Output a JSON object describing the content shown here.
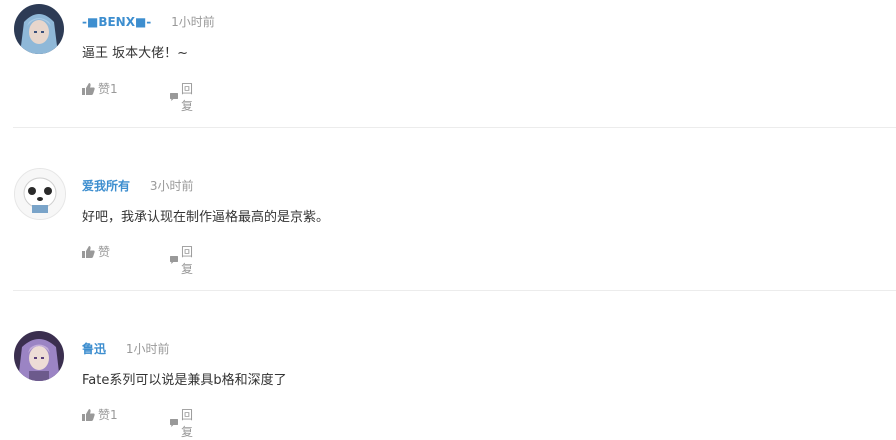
{
  "comments": [
    {
      "username": "-■BENX■-",
      "time": "1小时前",
      "content": "逼王 坂本大佬！~",
      "like_label": "赞1",
      "reply_label": "回复"
    },
    {
      "username": "爱我所有",
      "time": "3小时前",
      "content": "好吧，我承认现在制作逼格最高的是京紫。",
      "like_label": "赞",
      "reply_label": "回复"
    },
    {
      "username": "鲁迅",
      "time": "1小时前",
      "content": "Fate系列可以说是兼具b格和深度了",
      "like_label": "赞1",
      "reply_label": "回复"
    }
  ],
  "colors": {
    "username": "#3d8ecf",
    "meta": "#999999",
    "text": "#333333",
    "divider": "#ececec"
  },
  "icons": {
    "like": "thumbs-up-icon",
    "reply": "speech-bubble-icon"
  }
}
